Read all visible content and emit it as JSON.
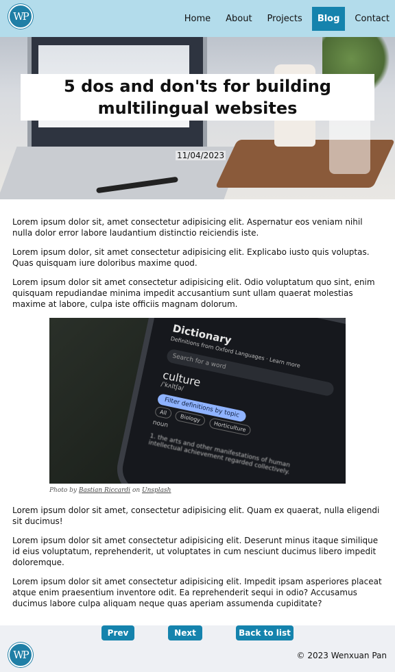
{
  "header": {
    "logo_text": "WP",
    "nav": [
      {
        "label": "Home"
      },
      {
        "label": "About"
      },
      {
        "label": "Projects"
      },
      {
        "label": "Blog"
      },
      {
        "label": "Contact"
      }
    ],
    "active_nav": "Blog"
  },
  "hero": {
    "title": "5 dos and don'ts for building multilingual websites",
    "date": "11/04/2023"
  },
  "article": {
    "paragraphs_top": [
      "Lorem ipsum dolor sit, amet consectetur adipisicing elit. Aspernatur eos veniam nihil nulla dolor error labore laudantium distinctio reiciendis iste.",
      "Lorem ipsum dolor, sit amet consectetur adipisicing elit. Explicabo iusto quis voluptas. Quas quisquam iure doloribus maxime quod.",
      "Lorem ipsum dolor sit amet consectetur adipisicing elit. Odio voluptatum quo sint, enim quisquam repudiandae minima impedit accusantium sunt ullam quaerat molestias maxime at labore, culpa iste officiis magnam dolorum."
    ],
    "figure": {
      "screen": {
        "title": "Dictionary",
        "subtitle": "Definitions from Oxford Languages · Learn more",
        "search_placeholder": "Search for a word",
        "word": "culture",
        "phonetic": "/ˈkʌltʃə/",
        "filter": "Filter definitions by topic",
        "chips": [
          "All",
          "Biology",
          "Horticulture"
        ],
        "pos": "noun",
        "definition": "1. the arts and other manifestations of human intellectual achievement regarded collectively."
      },
      "caption_prefix": "Photo by",
      "caption_author": "Bastian Riccardi",
      "caption_mid": "on",
      "caption_source": "Unsplash"
    },
    "paragraphs_bottom": [
      "Lorem ipsum dolor sit amet, consectetur adipisicing elit. Quam ex quaerat, nulla eligendi sit ducimus!",
      "Lorem ipsum dolor sit amet consectetur adipisicing elit. Deserunt minus itaque similique id eius voluptatum, reprehenderit, ut voluptates in cum nesciunt ducimus libero impedit doloremque.",
      "Lorem ipsum dolor sit amet consectetur adipisicing elit. Impedit ipsam asperiores placeat atque enim praesentium inventore odit. Ea reprehenderit sequi in odio? Accusamus ducimus labore culpa aliquam neque quas aperiam assumenda cupiditate?"
    ]
  },
  "pager": {
    "prev_label": "Prev",
    "next_label": "Next",
    "back_label": "Back to list"
  },
  "footer": {
    "logo_text": "WP",
    "copyright": "© 2023 Wenxuan Pan"
  },
  "colors": {
    "header_bg": "#b3dceb",
    "accent": "#1583ad",
    "footer_bg": "#eef0f4"
  }
}
